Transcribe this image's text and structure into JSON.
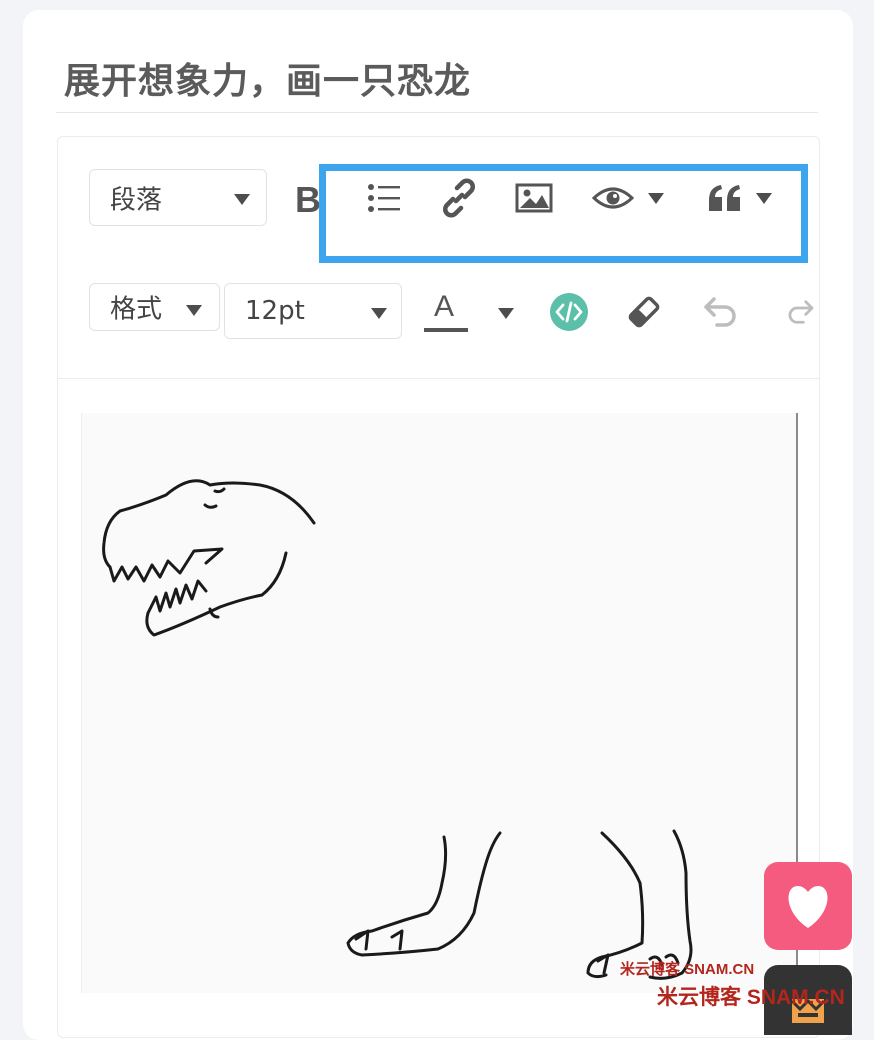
{
  "page": {
    "title": "展开想象力，画一只恐龙"
  },
  "toolbar": {
    "row1": {
      "paragraph_select": {
        "value": "段落"
      },
      "bold_label": "B",
      "list_icon": "unordered-list-icon",
      "link_icon": "link-icon",
      "image_icon": "image-icon",
      "preview_icon": "eye-icon",
      "quote_icon": "quote-icon"
    },
    "row2": {
      "format_select": {
        "value": "格式"
      },
      "font_size_select": {
        "value": "12pt"
      },
      "font_color_label": "A",
      "code_icon": "code-icon",
      "eraser_icon": "eraser-icon",
      "undo_icon": "undo-icon",
      "redo_icon": "redo-icon"
    }
  },
  "colors": {
    "highlight": "#3da4ee",
    "code_button": "#5bbfa9",
    "heart_button": "#f55b7f",
    "title_text": "#5b5b5b"
  },
  "floating": {
    "heart_icon": "heart-icon",
    "crown_icon": "crown-icon"
  },
  "watermark": {
    "line1": "米云博客  SNAM.CN",
    "line2": "米云博客  SNAM.CN"
  }
}
